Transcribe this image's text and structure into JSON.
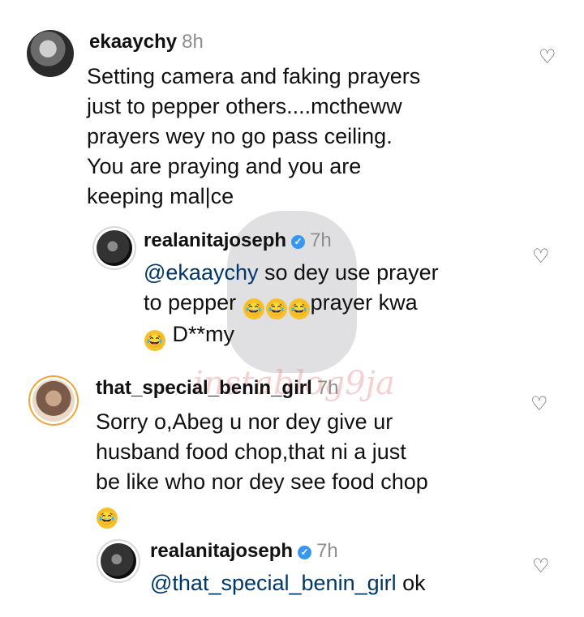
{
  "comments": [
    {
      "username": "ekaaychy",
      "time": "8h",
      "lines": [
        "Setting camera and faking prayers",
        "just to pepper others....mctheww",
        "prayers wey no go pass ceiling.",
        "You are praying and you are",
        "keeping mal|ce"
      ]
    },
    {
      "username": "realanitajoseph",
      "time": "7h",
      "mention": "@ekaaychy",
      "line1_rest": " so dey use prayer",
      "line2_start": "to pepper ",
      "line2_end": "prayer kwa",
      "line3_end": "D**my"
    },
    {
      "username": "that_special_benin_girl",
      "time": "7h",
      "lines": [
        "Sorry o,Abeg u nor dey give ur",
        "husband food chop,that ni  a just",
        "be like who nor dey see food chop"
      ]
    },
    {
      "username": "realanitajoseph",
      "time": "7h",
      "mention": "@that_special_benin_girl",
      "rest": " ok"
    }
  ],
  "watermark": "instablog9ja",
  "icons": {
    "like": "heart-outline-icon",
    "verified": "verified-badge-icon",
    "emoji": "laughing-tears-emoji"
  }
}
